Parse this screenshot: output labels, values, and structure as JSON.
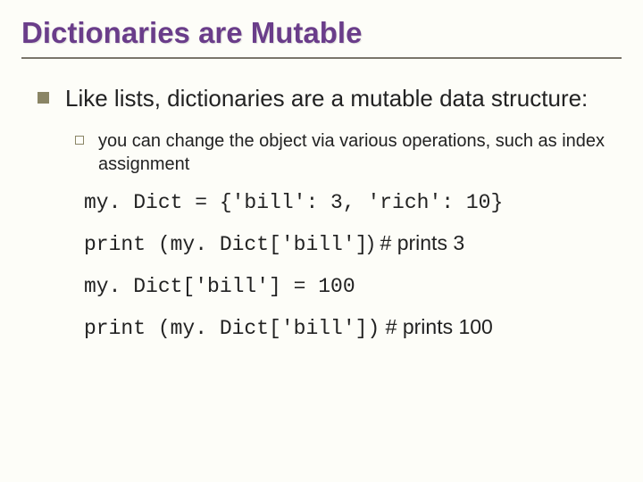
{
  "title": "Dictionaries are Mutable",
  "bullet1": "Like lists, dictionaries are a mutable data structure:",
  "sub1": "you can change the object via various operations, such as index assignment",
  "code": {
    "l1": "my. Dict = {'bill': 3, 'rich': 10}",
    "l2a": "print (my. Dict['bill']",
    "l2b": ")",
    "l2c": "  # prints 3",
    "l3": "my. Dict['bill'] = 100",
    "l4a": "print (my. Dict['bill'])",
    "l4b": "  # prints 100"
  }
}
